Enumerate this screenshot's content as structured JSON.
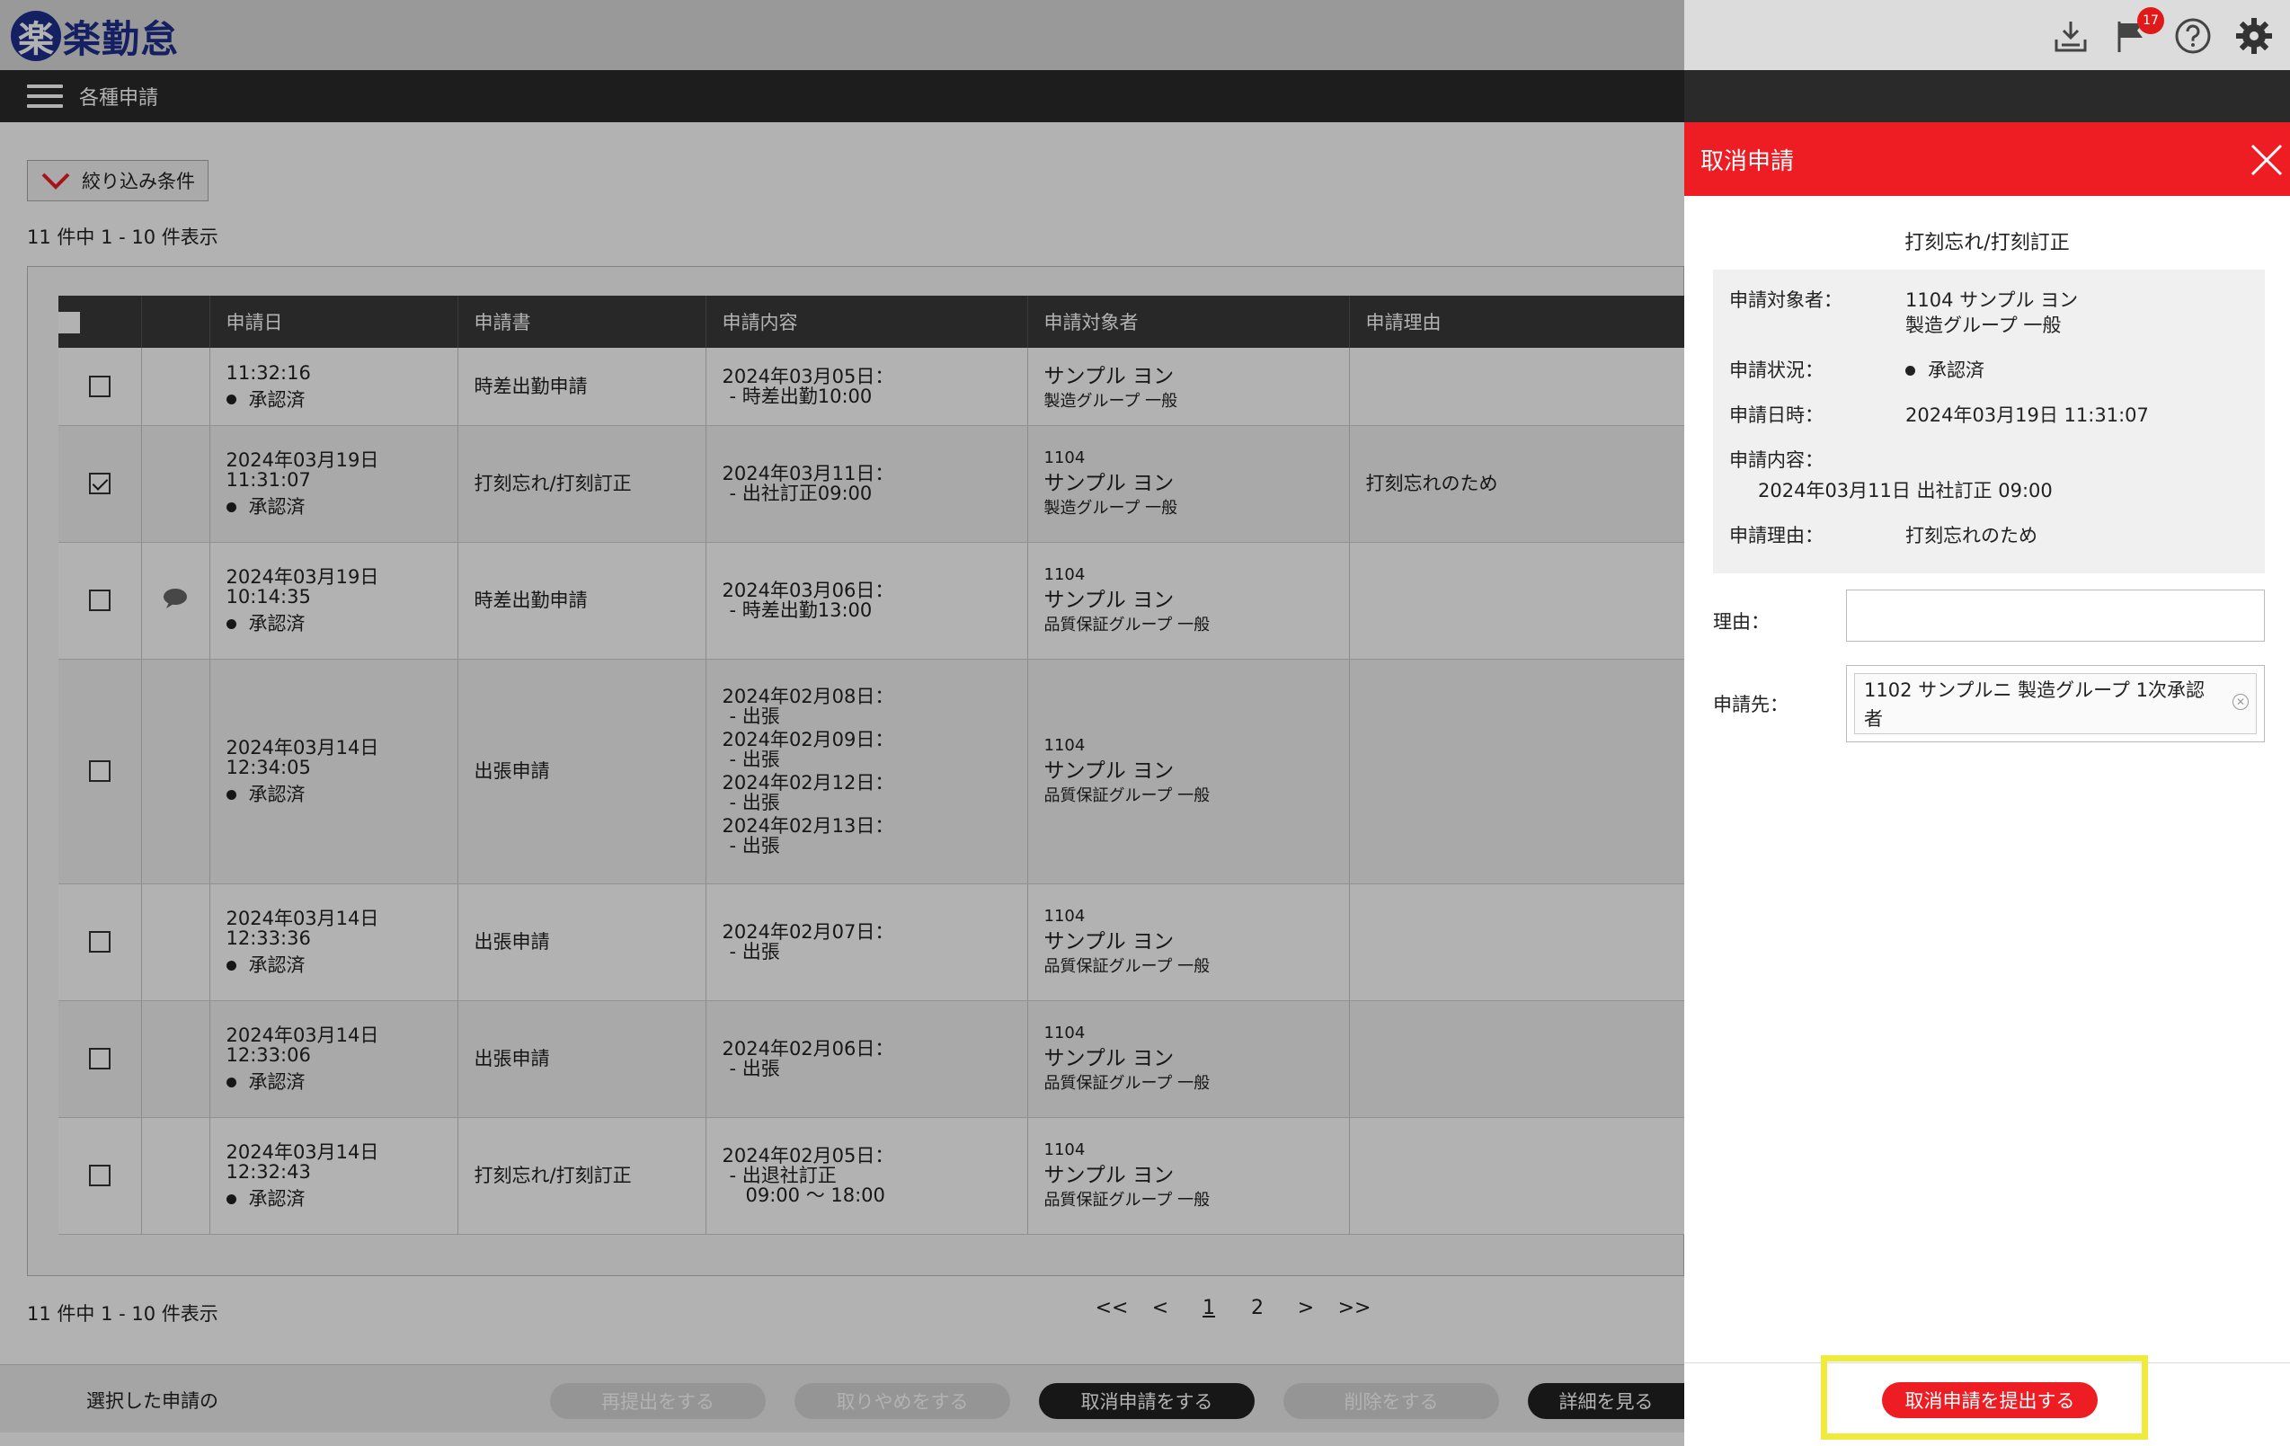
{
  "app": {
    "logo_mark": "楽",
    "logo_text": "楽勤怠",
    "notification_count": "17"
  },
  "nav": {
    "title": "各種申請"
  },
  "filter": {
    "label": "絞り込み条件"
  },
  "count_text": "11 件中 1 - 10 件表示",
  "table": {
    "headers": [
      "申請日",
      "申請書",
      "申請内容",
      "申請対象者",
      "申請理由"
    ],
    "rows": [
      {
        "checked": false,
        "comment": false,
        "date": "",
        "time": "11:32:16",
        "status": "承認済",
        "form": "時差出勤申請",
        "contents": [
          {
            "d": "2024年03月05日：",
            "s": "- 時差出勤10:00"
          }
        ],
        "num": "",
        "name": "サンプル ヨン",
        "group": "製造グループ 一般",
        "reason": ""
      },
      {
        "checked": true,
        "comment": false,
        "date": "2024年03月19日",
        "time": "11:31:07",
        "status": "承認済",
        "form": "打刻忘れ/打刻訂正",
        "contents": [
          {
            "d": "2024年03月11日：",
            "s": "- 出社訂正09:00"
          }
        ],
        "num": "1104",
        "name": "サンプル ヨン",
        "group": "製造グループ 一般",
        "reason": "打刻忘れのため"
      },
      {
        "checked": false,
        "comment": true,
        "date": "2024年03月19日",
        "time": "10:14:35",
        "status": "承認済",
        "form": "時差出勤申請",
        "contents": [
          {
            "d": "2024年03月06日：",
            "s": "- 時差出勤13:00"
          }
        ],
        "num": "1104",
        "name": "サンプル ヨン",
        "group": "品質保証グループ 一般",
        "reason": ""
      },
      {
        "checked": false,
        "comment": false,
        "date": "2024年03月14日",
        "time": "12:34:05",
        "status": "承認済",
        "form": "出張申請",
        "contents": [
          {
            "d": "2024年02月08日：",
            "s": "- 出張"
          },
          {
            "d": "2024年02月09日：",
            "s": "- 出張"
          },
          {
            "d": "2024年02月12日：",
            "s": "- 出張"
          },
          {
            "d": "2024年02月13日：",
            "s": "- 出張"
          }
        ],
        "num": "1104",
        "name": "サンプル ヨン",
        "group": "品質保証グループ 一般",
        "reason": ""
      },
      {
        "checked": false,
        "comment": false,
        "date": "2024年03月14日",
        "time": "12:33:36",
        "status": "承認済",
        "form": "出張申請",
        "contents": [
          {
            "d": "2024年02月07日：",
            "s": "- 出張"
          }
        ],
        "num": "1104",
        "name": "サンプル ヨン",
        "group": "品質保証グループ 一般",
        "reason": ""
      },
      {
        "checked": false,
        "comment": false,
        "date": "2024年03月14日",
        "time": "12:33:06",
        "status": "承認済",
        "form": "出張申請",
        "contents": [
          {
            "d": "2024年02月06日：",
            "s": "- 出張"
          }
        ],
        "num": "1104",
        "name": "サンプル ヨン",
        "group": "品質保証グループ 一般",
        "reason": ""
      },
      {
        "checked": false,
        "comment": false,
        "date": "2024年03月14日",
        "time": "12:32:43",
        "status": "承認済",
        "form": "打刻忘れ/打刻訂正",
        "contents": [
          {
            "d": "2024年02月05日：",
            "s": "- 出退社訂正",
            "s2": "09:00 ～ 18:00"
          }
        ],
        "num": "1104",
        "name": "サンプル ヨン",
        "group": "品質保証グループ 一般",
        "reason": ""
      }
    ]
  },
  "pager": {
    "first": "<<",
    "prev": "<",
    "pages": [
      "1",
      "2"
    ],
    "current": "1",
    "next": ">",
    "last": ">>"
  },
  "action_bar": {
    "label": "選択した申請の",
    "buttons": [
      {
        "label": "再提出をする",
        "state": "disabled"
      },
      {
        "label": "取りやめをする",
        "state": "disabled"
      },
      {
        "label": "取消申請をする",
        "state": "active"
      },
      {
        "label": "削除をする",
        "state": "disabled"
      },
      {
        "label": "詳細を見る",
        "state": "active"
      }
    ]
  },
  "panel": {
    "title": "取消申請",
    "subtitle": "打刻忘れ/打刻訂正",
    "target_label": "申請対象者：",
    "target_line1": "1104 サンプル ヨン",
    "target_line2": "製造グループ 一般",
    "status_label": "申請状況：",
    "status_value": "承認済",
    "datetime_label": "申請日時：",
    "datetime_value": "2024年03月19日 11:31:07",
    "content_label": "申請内容：",
    "content_value": "2024年03月11日  出社訂正  09:00",
    "reason_label": "申請理由：",
    "reason_value": "打刻忘れのため",
    "form_reason_label": "理由：",
    "form_reason_value": "",
    "dest_label": "申請先：",
    "dest_value": "1102 サンプルニ 製造グループ 1次承認者",
    "submit_label": "取消申請を提出する"
  },
  "colors": {
    "accent": "#ee1c23",
    "brand": "#1d2f8c",
    "highlight": "#f0ea3c"
  }
}
